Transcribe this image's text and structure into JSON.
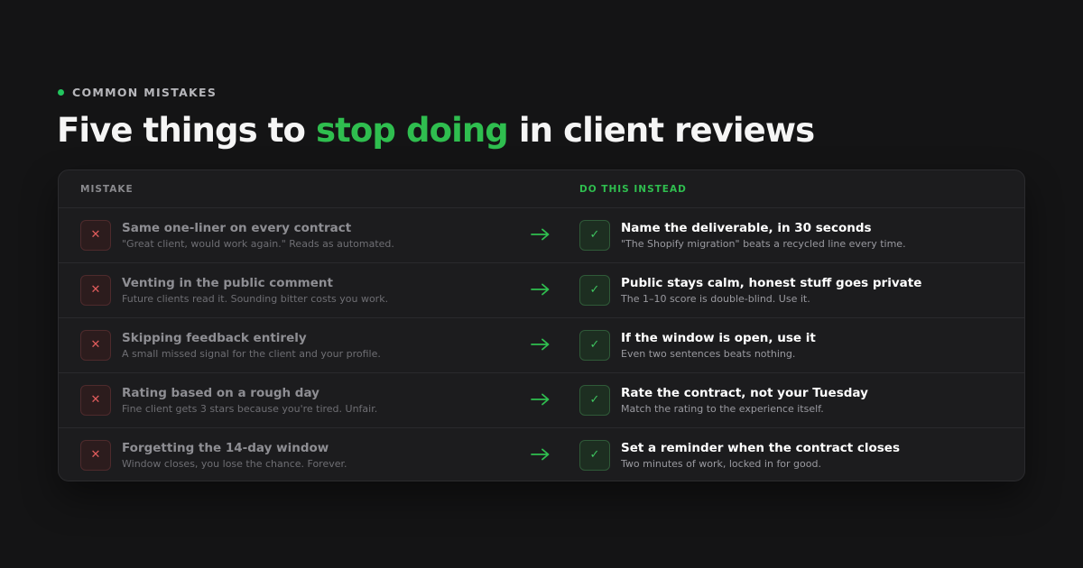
{
  "eyebrow": "COMMON MISTAKES",
  "headline": {
    "before": "Five things to ",
    "accent": "stop doing",
    "after": " in client reviews"
  },
  "table": {
    "header_mistake": "MISTAKE",
    "header_instead": "DO THIS INSTEAD",
    "rows": [
      {
        "mistake_title": "Same one-liner on every contract",
        "mistake_desc": "\"Great client, would work again.\" Reads as automated.",
        "instead_title": "Name the deliverable, in 30 seconds",
        "instead_desc": "\"The Shopify migration\" beats a recycled line every time."
      },
      {
        "mistake_title": "Venting in the public comment",
        "mistake_desc": "Future clients read it. Sounding bitter costs you work.",
        "instead_title": "Public stays calm, honest stuff goes private",
        "instead_desc": "The 1–10 score is double-blind. Use it."
      },
      {
        "mistake_title": "Skipping feedback entirely",
        "mistake_desc": "A small missed signal for the client and your profile.",
        "instead_title": "If the window is open, use it",
        "instead_desc": "Even two sentences beats nothing."
      },
      {
        "mistake_title": "Rating based on a rough day",
        "mistake_desc": "Fine client gets 3 stars because you're tired. Unfair.",
        "instead_title": "Rate the contract, not your Tuesday",
        "instead_desc": "Match the rating to the experience itself."
      },
      {
        "mistake_title": "Forgetting the 14-day window",
        "mistake_desc": "Window closes, you lose the chance. Forever.",
        "instead_title": "Set a reminder when the contract closes",
        "instead_desc": "Two minutes of work, locked in for good."
      }
    ]
  },
  "icons": {
    "mistake": "x-icon",
    "instead": "checkmark-icon",
    "arrow": "arrow-right-icon",
    "eyebrow": "dot-icon"
  },
  "colors": {
    "background": "#141415",
    "card": "#1c1c1e",
    "accent_green": "#2fbe4f",
    "mistake_red": "#e05c5c"
  }
}
